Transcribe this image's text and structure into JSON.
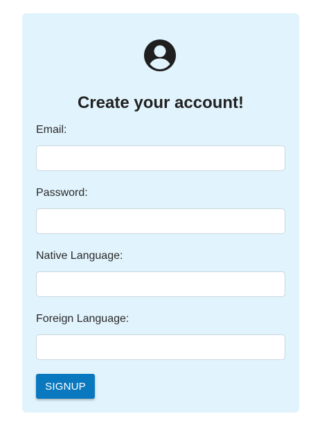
{
  "form": {
    "avatar_icon": "account-circle-icon",
    "title": "Create your account!",
    "fields": [
      {
        "label": "Email:",
        "value": "",
        "placeholder": ""
      },
      {
        "label": "Password:",
        "value": "",
        "placeholder": ""
      },
      {
        "label": "Native Language:",
        "value": "",
        "placeholder": ""
      },
      {
        "label": "Foreign Language:",
        "value": "",
        "placeholder": ""
      }
    ],
    "submit_label": "SIGNUP"
  },
  "colors": {
    "card_background": "#e1f3fc",
    "button": "#0a78be",
    "button_text": "#ffffff",
    "title_text": "#212121"
  }
}
